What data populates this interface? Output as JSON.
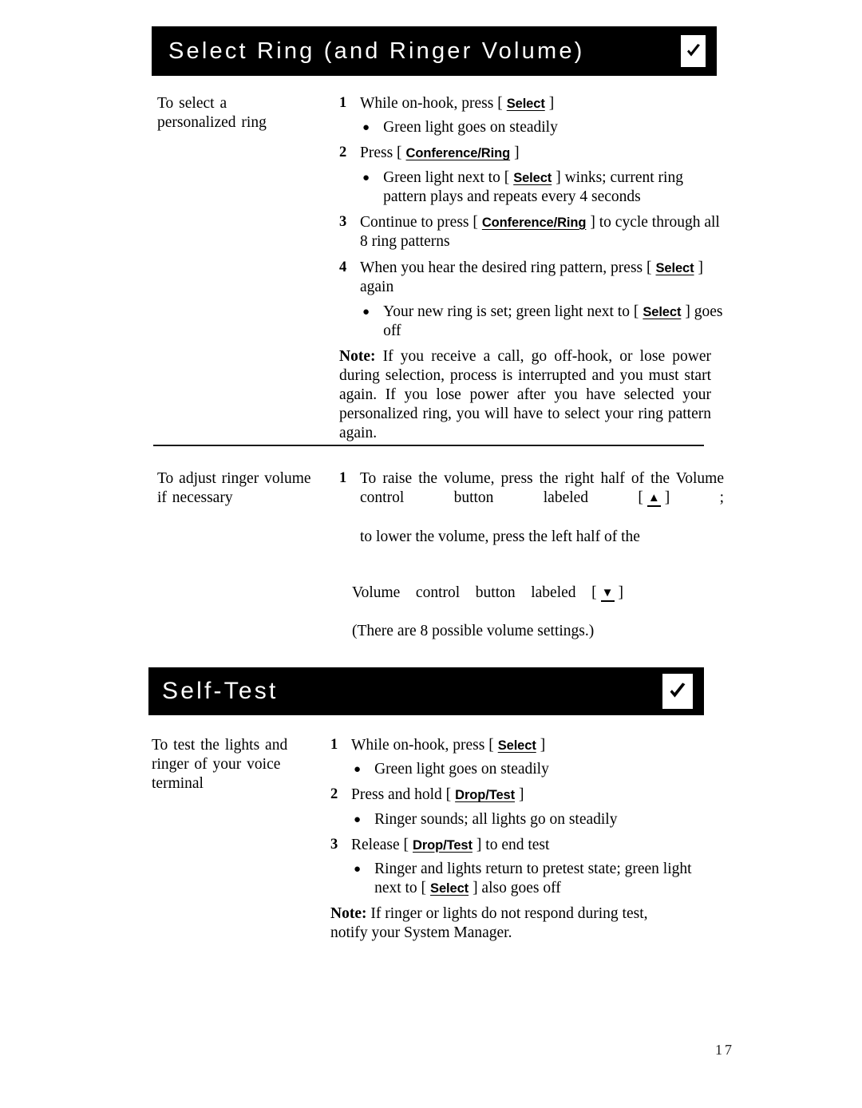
{
  "page": {
    "number": "17"
  },
  "sections": [
    {
      "id": "select-ring",
      "title": "Select Ring (and Ringer Volume)",
      "checkmark_icon": "checkmark-icon",
      "procedures": [
        {
          "id": "select-personalized-ring",
          "label": "To select a personalized ring",
          "label_lines": [
            "To select a",
            "personalized ring"
          ],
          "steps": [
            {
              "number": "1",
              "text_before": "While on-hook, press [",
              "key": "Select",
              "text_after": "]",
              "bullets": [
                {
                  "text": "Green light goes on steadily"
                }
              ]
            },
            {
              "number": "2",
              "text_before": "Press [",
              "key": "Conference/Ring",
              "text_after": "]",
              "bullets": [
                {
                  "text_before": "Green light next to [",
                  "key": "Select",
                  "text_after": "] winks; current ring pattern plays and repeats every 4 seconds"
                }
              ]
            },
            {
              "number": "3",
              "text_before": "Continue to press [",
              "key": "Conference/Ring",
              "text_after": "] to cycle through all 8 ring patterns",
              "bullets": []
            },
            {
              "number": "4",
              "text_before": "When you hear the desired ring pattern, press [",
              "key": "Select",
              "text_after": "] again",
              "bullets": [
                {
                  "text_before": "Your new ring is set; green light next to [",
                  "key": "Select",
                  "text_after": "] goes off"
                }
              ]
            }
          ],
          "note": {
            "label": "Note:",
            "text": "If you receive a call, go off-hook, or lose power during selection, process is interrupted and you must start again. If you lose power after you have selected your personalized ring, you will have to select your ring pattern again."
          }
        },
        {
          "id": "adjust-ringer-volume",
          "label": "To adjust ringer volume if necessary",
          "label_lines": [
            "To adjust ringer volume",
            "if necessary"
          ],
          "steps": [
            {
              "number": "1",
              "text_before": "To raise the volume, press the right half of the Volume control button labeled [",
              "key_glyph": "▲",
              "text_after": "] ;",
              "text_continue": "to lower the volume, press the left half of the",
              "bullets": []
            }
          ],
          "continued": {
            "text_before": "Volume control button labeled [",
            "key_glyph": "▼",
            "text_after": "]",
            "parenthetical": "(There are 8 possible volume settings.)"
          }
        }
      ]
    },
    {
      "id": "self-test",
      "title": "Self-Test",
      "checkmark_icon": "checkmark-icon",
      "procedures": [
        {
          "id": "test-lights-and-ringer",
          "label": "To test the lights and ringer of your voice terminal",
          "label_lines": [
            "To test the lights and",
            "ringer of your voice",
            "terminal"
          ],
          "steps": [
            {
              "number": "1",
              "text_before": "While on-hook, press [",
              "key": "Select",
              "text_after": "]",
              "bullets": [
                {
                  "text": "Green light goes on steadily"
                }
              ]
            },
            {
              "number": "2",
              "text_before": "Press and hold [",
              "key": "Drop/Test",
              "text_after": "]",
              "bullets": [
                {
                  "text": "Ringer sounds; all lights go on steadily"
                }
              ]
            },
            {
              "number": "3",
              "text_before": "Release [",
              "key": "Drop/Test",
              "text_after": "] to end test",
              "bullets": [
                {
                  "text_before": "Ringer and lights return to pretest state; green light next to [",
                  "key": "Select",
                  "text_after": "] also goes off"
                }
              ]
            }
          ],
          "note": {
            "label": "Note:",
            "text": "If ringer or lights do not respond during test, notify your System Manager."
          }
        }
      ]
    }
  ]
}
